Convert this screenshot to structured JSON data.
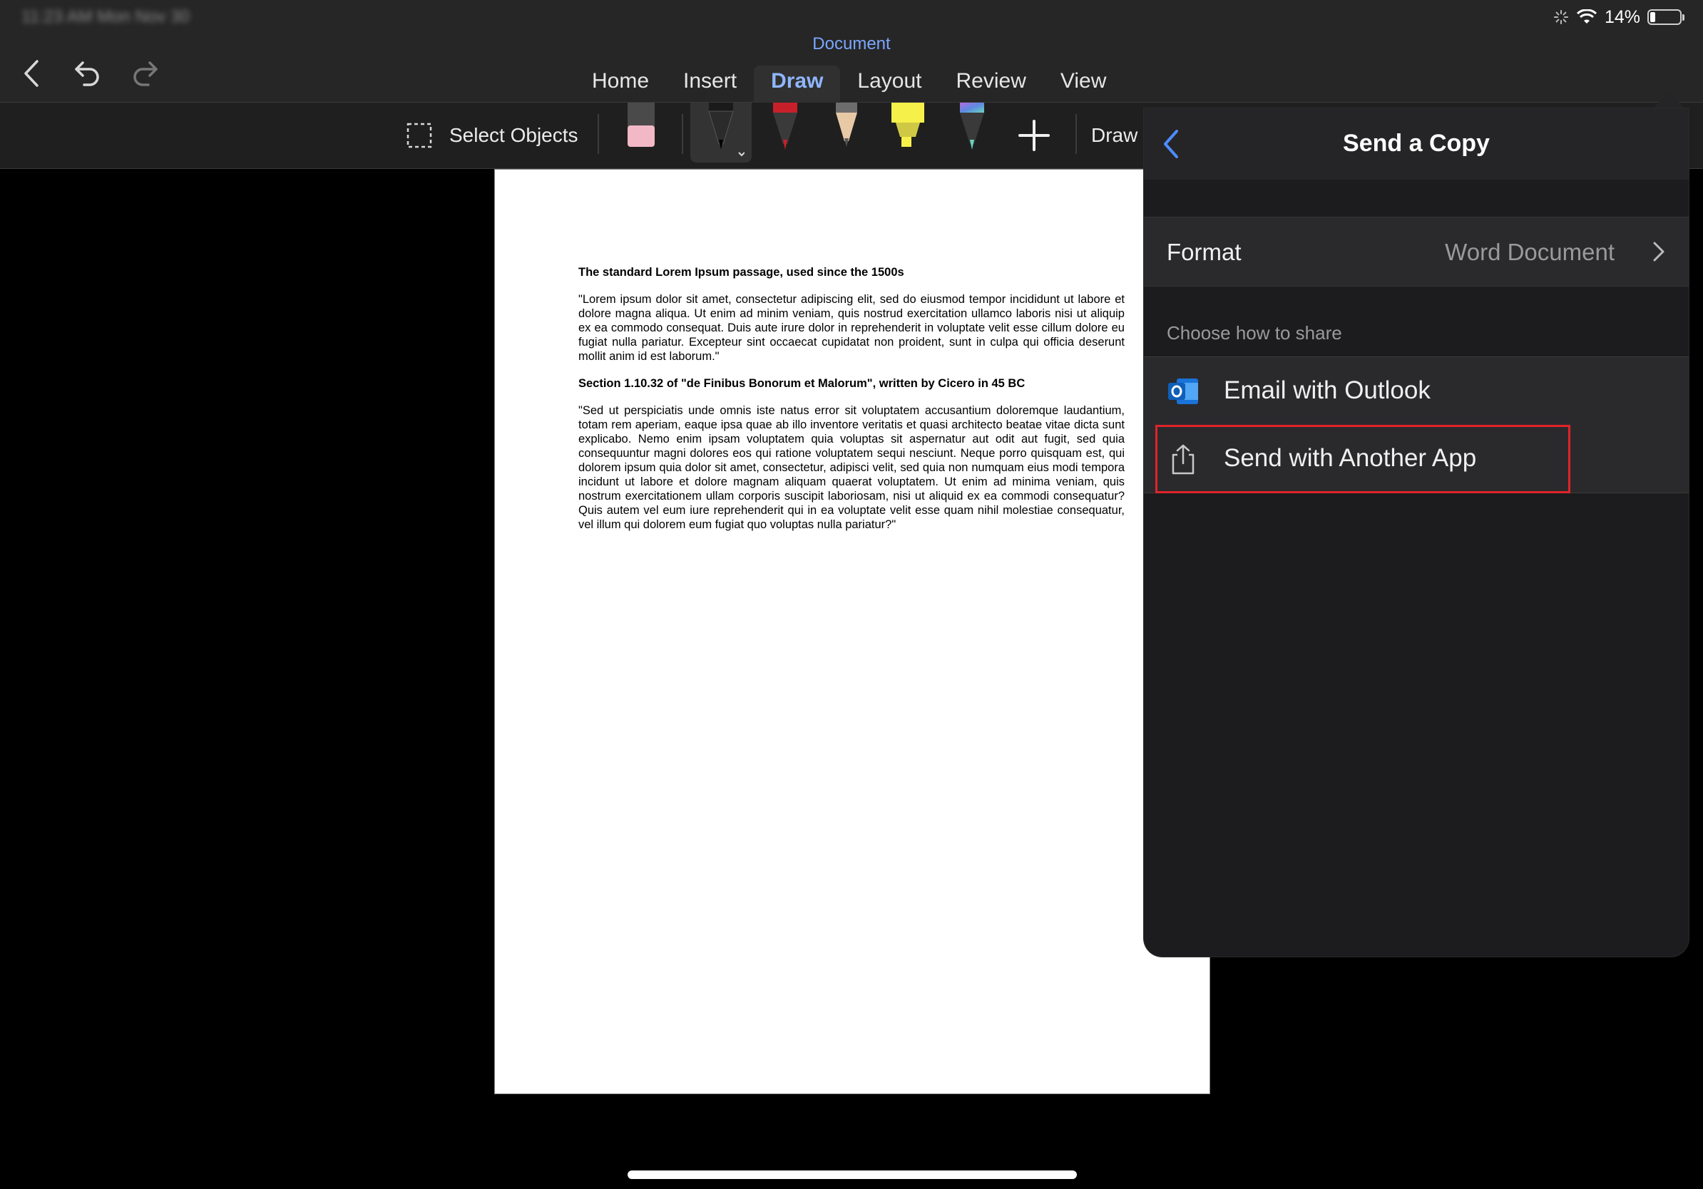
{
  "status_bar": {
    "time": "11:23 AM  Mon Nov 30",
    "battery": "14%"
  },
  "document_title": "Document",
  "ribbon": {
    "tabs": [
      {
        "label": "Home"
      },
      {
        "label": "Insert"
      },
      {
        "label": "Draw",
        "active": true
      },
      {
        "label": "Layout"
      },
      {
        "label": "Review"
      },
      {
        "label": "View"
      }
    ]
  },
  "toolbar": {
    "select_objects": "Select Objects",
    "draw_label": "Draw w",
    "tools": [
      "eraser-icon",
      "pen-black-icon",
      "pen-red-icon",
      "pencil-icon",
      "highlighter-yellow-icon",
      "pen-galaxy-icon",
      "add-tool-icon"
    ],
    "colors": {
      "pen_red": "#c8202a",
      "highlighter": "#f6f04a",
      "accent": "#7aa7ff"
    }
  },
  "document": {
    "heading1": "The standard Lorem Ipsum passage, used since the 1500s",
    "para1": "\"Lorem ipsum dolor sit amet, consectetur adipiscing elit, sed do eiusmod tempor incididunt ut labore et dolore magna aliqua. Ut enim ad minim veniam, quis nostrud exercitation ullamco laboris nisi ut aliquip ex ea commodo consequat. Duis aute irure dolor in reprehenderit in voluptate velit esse cillum dolore eu fugiat nulla pariatur. Excepteur sint occaecat cupidatat non proident, sunt in culpa qui officia deserunt mollit anim id est laborum.\"",
    "heading2": "Section 1.10.32 of \"de Finibus Bonorum et Malorum\", written by Cicero in 45 BC",
    "para2": "\"Sed ut perspiciatis unde omnis iste natus error sit voluptatem accusantium doloremque laudantium, totam rem aperiam, eaque ipsa quae ab illo inventore veritatis et quasi architecto beatae vitae dicta sunt explicabo. Nemo enim ipsam voluptatem quia voluptas sit aspernatur aut odit aut fugit, sed quia consequuntur magni dolores eos qui ratione voluptatem sequi nesciunt. Neque porro quisquam est, qui dolorem ipsum quia dolor sit amet, consectetur, adipisci velit, sed quia non numquam eius modi tempora incidunt ut labore et dolore magnam aliquam quaerat voluptatem. Ut enim ad minima veniam, quis nostrum exercitationem ullam corporis suscipit laboriosam, nisi ut aliquid ex ea commodi consequatur? Quis autem vel eum iure reprehenderit qui in ea voluptate velit esse quam nihil molestiae consequatur, vel illum qui dolorem eum fugiat quo voluptas nulla pariatur?\""
  },
  "send_copy_panel": {
    "title": "Send a Copy",
    "format_label": "Format",
    "format_value": "Word Document",
    "choose_label": "Choose how to share",
    "options": [
      {
        "label": "Email with Outlook",
        "icon": "outlook-icon"
      },
      {
        "label": "Send with Another App",
        "icon": "share-icon",
        "highlighted": true
      }
    ],
    "highlight_color": "#e0232a"
  }
}
